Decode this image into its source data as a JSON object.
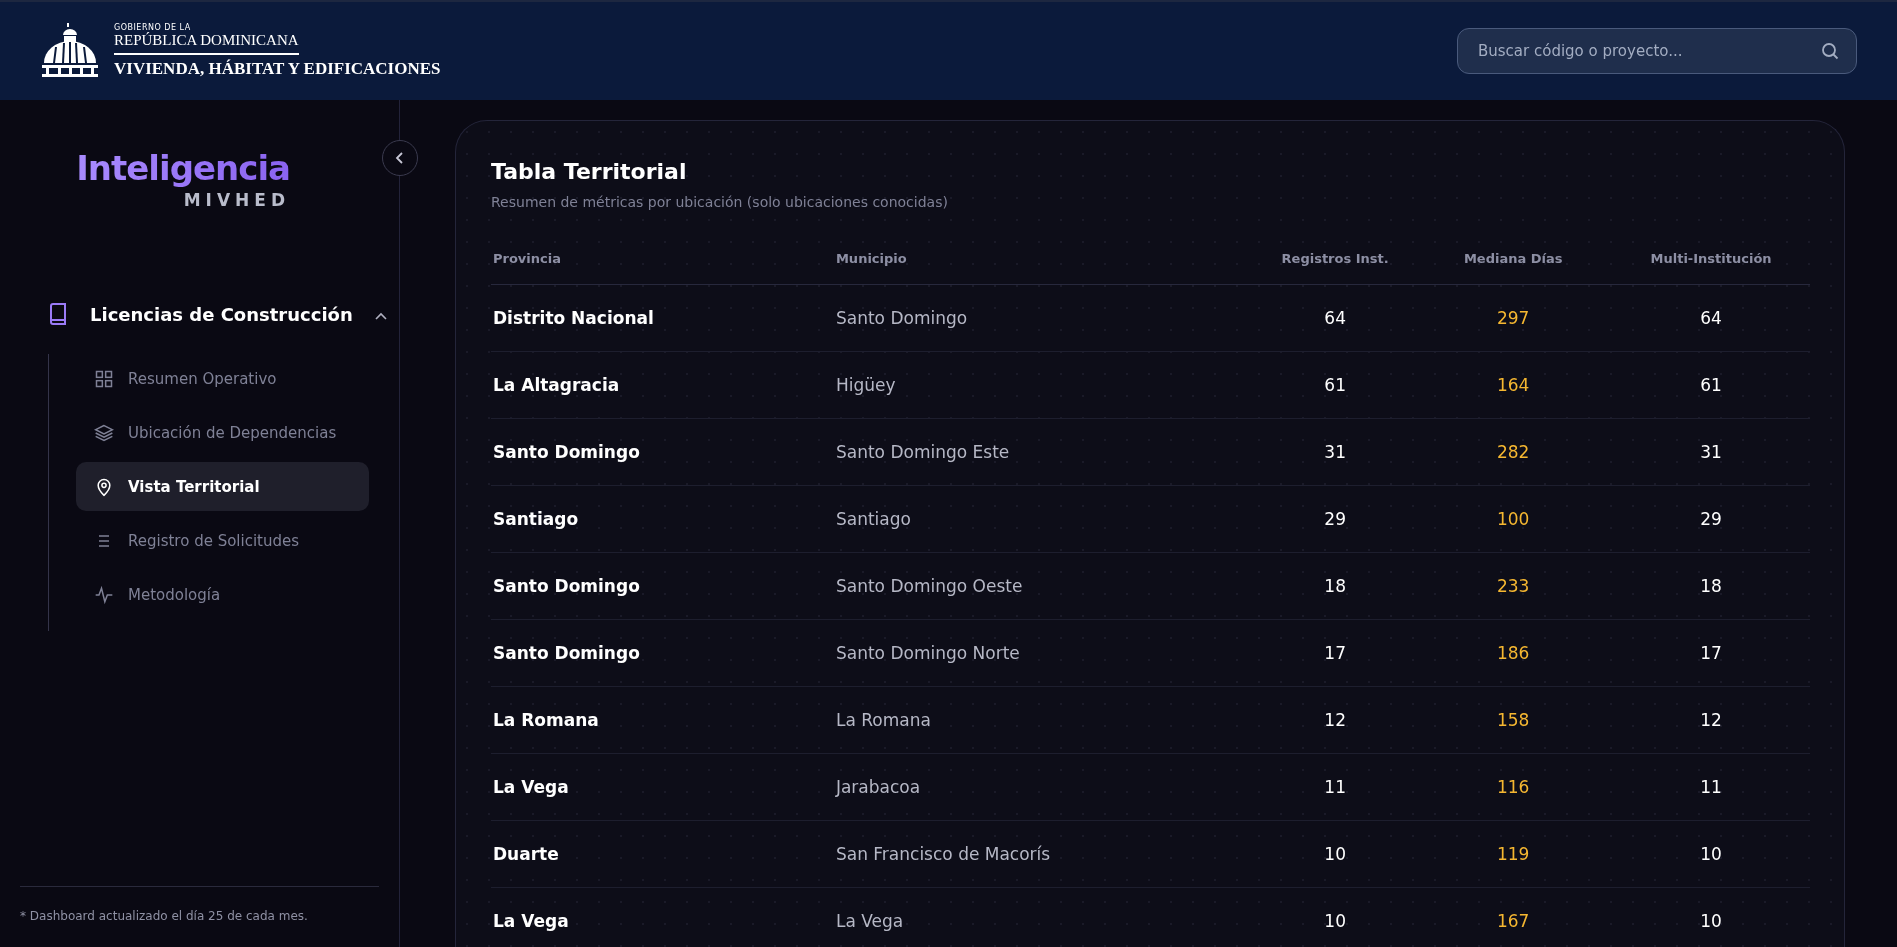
{
  "header": {
    "logo_small": "GOBIERNO DE LA",
    "logo_main": "REPÚBLICA DOMINICANA",
    "logo_ministry": "VIVIENDA, HÁBITAT Y EDIFICACIONES",
    "search": {
      "placeholder": "Buscar código o proyecto..."
    }
  },
  "sidebar": {
    "brand_title": "Inteligencia",
    "brand_subtitle": "MIVHED",
    "section": {
      "label": "Licencias de Construcción",
      "expanded": true,
      "items": [
        {
          "label": "Resumen Operativo",
          "kind": "grid",
          "selected": false
        },
        {
          "label": "Ubicación de Dependencias",
          "kind": "layers",
          "selected": false
        },
        {
          "label": "Vista Territorial",
          "kind": "pin",
          "selected": true
        },
        {
          "label": "Registro de Solicitudes",
          "kind": "list",
          "selected": false
        },
        {
          "label": "Metodología",
          "kind": "pulse",
          "selected": false
        }
      ]
    },
    "footer_note": "* Dashboard actualizado el día 25 de cada mes."
  },
  "table": {
    "title": "Tabla Territorial",
    "subtitle": "Resumen de métricas por ubicación (solo ubicaciones conocidas)",
    "columns": [
      "Provincia",
      "Municipio",
      "Registros Inst.",
      "Mediana Días",
      "Multi-Institución"
    ],
    "rows": [
      [
        "Distrito Nacional",
        "Santo Domingo",
        "64",
        "297",
        "64"
      ],
      [
        "La Altagracia",
        "Higüey",
        "61",
        "164",
        "61"
      ],
      [
        "Santo Domingo",
        "Santo Domingo Este",
        "31",
        "282",
        "31"
      ],
      [
        "Santiago",
        "Santiago",
        "29",
        "100",
        "29"
      ],
      [
        "Santo Domingo",
        "Santo Domingo Oeste",
        "18",
        "233",
        "18"
      ],
      [
        "Santo Domingo",
        "Santo Domingo Norte",
        "17",
        "186",
        "17"
      ],
      [
        "La Romana",
        "La Romana",
        "12",
        "158",
        "12"
      ],
      [
        "La Vega",
        "Jarabacoa",
        "11",
        "116",
        "11"
      ],
      [
        "Duarte",
        "San Francisco de Macorís",
        "10",
        "119",
        "10"
      ],
      [
        "La Vega",
        "La Vega",
        "10",
        "167",
        "10"
      ]
    ]
  }
}
